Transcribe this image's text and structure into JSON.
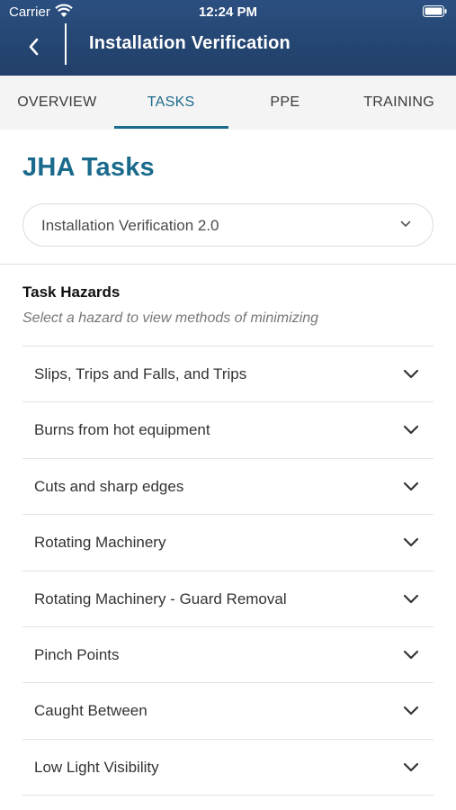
{
  "status_bar": {
    "carrier": "Carrier",
    "time": "12:24 PM"
  },
  "nav": {
    "title": "Installation Verification"
  },
  "tabs": [
    {
      "label": "OVERVIEW",
      "active": false
    },
    {
      "label": "TASKS",
      "active": true
    },
    {
      "label": "PPE",
      "active": false
    },
    {
      "label": "TRAINING",
      "active": false
    }
  ],
  "page": {
    "title": "JHA Tasks",
    "selected_task": "Installation Verification 2.0"
  },
  "hazards": {
    "heading": "Task Hazards",
    "subtitle": "Select a hazard to view methods of minimizing",
    "items": [
      {
        "label": "Slips, Trips and Falls, and Trips"
      },
      {
        "label": "Burns from hot equipment"
      },
      {
        "label": "Cuts and sharp edges"
      },
      {
        "label": "Rotating Machinery"
      },
      {
        "label": "Rotating Machinery - Guard Removal"
      },
      {
        "label": "Pinch Points"
      },
      {
        "label": "Caught Between"
      },
      {
        "label": "Low Light Visibility"
      }
    ]
  },
  "colors": {
    "header": "#24446f",
    "accent": "#1c6a8c",
    "tab_bar": "#f4f4f4"
  },
  "icons": {
    "back": "chevron-left-icon",
    "dropdown": "chevron-down-icon",
    "hazard": "chevron-down-icon",
    "wifi": "wifi-icon",
    "battery": "battery-icon"
  }
}
